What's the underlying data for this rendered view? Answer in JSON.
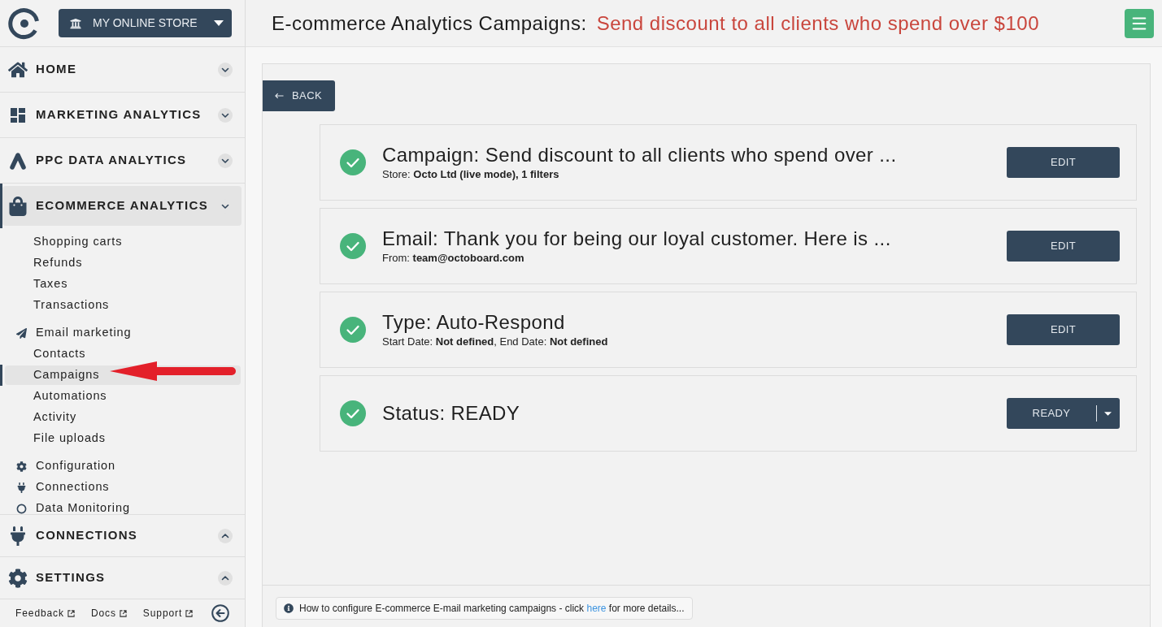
{
  "sidebar": {
    "store_selector": {
      "label": "MY ONLINE STORE"
    },
    "nav": [
      {
        "label": "HOME",
        "selected": false
      },
      {
        "label": "MARKETING ANALYTICS",
        "selected": false
      },
      {
        "label": "PPC DATA ANALYTICS",
        "selected": false
      },
      {
        "label": "ECOMMERCE ANALYTICS",
        "selected": true,
        "children": [
          {
            "label": "Shopping carts",
            "kind": "page",
            "selected": false
          },
          {
            "label": "Refunds",
            "kind": "page",
            "selected": false
          },
          {
            "label": "Taxes",
            "kind": "page",
            "selected": false
          },
          {
            "label": "Transactions",
            "kind": "page",
            "selected": false
          },
          {
            "label": "Email marketing",
            "kind": "group",
            "selected": false,
            "children": [
              {
                "label": "Contacts",
                "kind": "page",
                "selected": false
              },
              {
                "label": "Campaigns",
                "kind": "page",
                "selected": true
              },
              {
                "label": "Automations",
                "kind": "page",
                "selected": false
              },
              {
                "label": "Activity",
                "kind": "page",
                "selected": false
              },
              {
                "label": "File uploads",
                "kind": "page",
                "selected": false
              }
            ]
          },
          {
            "label": "Configuration",
            "kind": "tool",
            "selected": false
          },
          {
            "label": "Connections",
            "kind": "tool",
            "selected": false
          },
          {
            "label": "Data Monitoring",
            "kind": "tool",
            "selected": false
          }
        ]
      }
    ],
    "pinned": [
      {
        "label": "CONNECTIONS",
        "selected": false
      },
      {
        "label": "SETTINGS",
        "selected": false
      }
    ],
    "footer_links": [
      "Feedback",
      "Docs",
      "Support"
    ]
  },
  "header": {
    "title": "E-commerce Analytics Campaigns:",
    "campaign_name": "Send discount to all clients who spend over $100"
  },
  "back_button": "BACK",
  "steps": [
    {
      "title": "Campaign: Send discount to all clients who spend over ...",
      "detail": "Store: **Octo Ltd (live mode), 1 filters**",
      "done": true,
      "action": {
        "kind": "button",
        "label": "EDIT"
      }
    },
    {
      "title": "Email: Thank you for being our loyal customer. Here is ...",
      "detail": "From: **team@octoboard.com**",
      "done": true,
      "action": {
        "kind": "button",
        "label": "EDIT"
      }
    },
    {
      "title": "Type: Auto-Respond",
      "detail": "Start Date: **Not defined**, End Date: **Not defined**",
      "done": true,
      "action": {
        "kind": "button",
        "label": "EDIT"
      }
    },
    {
      "title": "Status: READY",
      "done": true,
      "action": {
        "kind": "split",
        "label": "READY"
      }
    }
  ],
  "help": {
    "text_before": "How to configure E-commerce E-mail marketing campaigns - click",
    "link": "here",
    "text_after": "for more details..."
  }
}
